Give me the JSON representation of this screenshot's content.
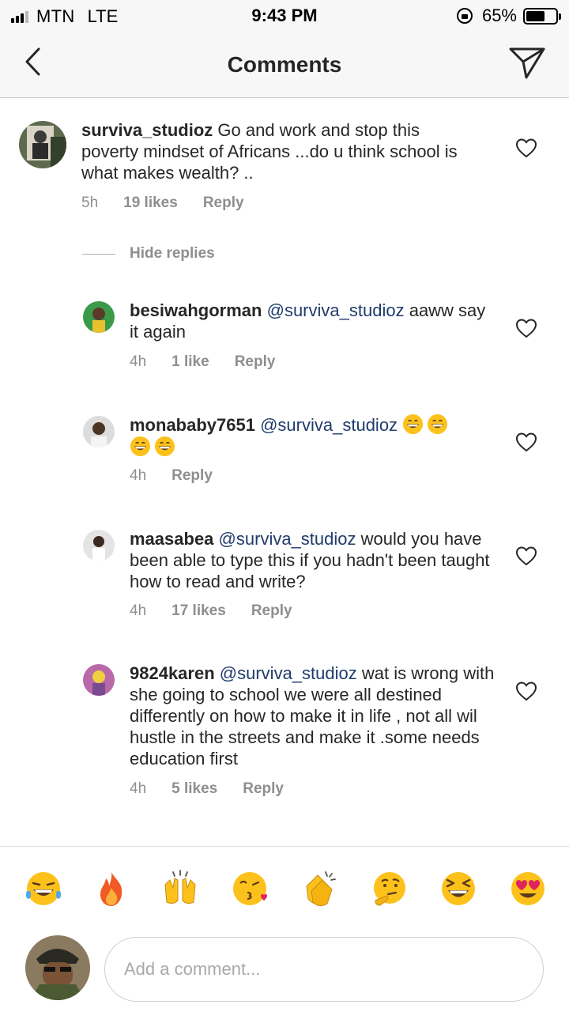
{
  "status_bar": {
    "carrier": "MTN",
    "network": "LTE",
    "time": "9:43 PM",
    "battery_text": "65%",
    "battery_level": 0.65,
    "signal_bars": 3,
    "icons": [
      "signal-icon",
      "orientation-lock-icon",
      "battery-icon"
    ]
  },
  "nav": {
    "title": "Comments",
    "back_icon": "chevron-left-icon",
    "send_icon": "paper-plane-icon"
  },
  "main_comment": {
    "username": "surviva_studioz",
    "text": "Go and work and stop this poverty mindset of Africans ...do u think school is what makes wealth? ..",
    "time": "5h",
    "likes": "19 likes",
    "reply": "Reply"
  },
  "hide_replies_label": "Hide replies",
  "replies": [
    {
      "username": "besiwahgorman",
      "mention": "@surviva_studioz",
      "text": "aaww say it again",
      "time": "4h",
      "likes": "1 like",
      "reply": "Reply"
    },
    {
      "username": "monababy7651",
      "mention": "@surviva_studioz",
      "text": "",
      "emojis": [
        "grinning-face",
        "grinning-face",
        "grinning-face",
        "grinning-face"
      ],
      "time": "4h",
      "likes": "",
      "reply": "Reply"
    },
    {
      "username": "maasabea",
      "mention": "@surviva_studioz",
      "text": "would you have been able to type this if you hadn't been taught how to read and write?",
      "time": "4h",
      "likes": "17 likes",
      "reply": "Reply"
    },
    {
      "username": "9824karen",
      "mention": "@surviva_studioz",
      "text": "wat is wrong with she going to school we were all destined differently on how to make it in life , not all wil hustle in the streets and make it .some needs education first",
      "time": "4h",
      "likes": "5 likes",
      "reply": "Reply"
    }
  ],
  "emoji_bar": [
    "tears-of-joy",
    "fire",
    "raising-hands",
    "face-blowing-kiss",
    "clapping-hands",
    "thinking-face",
    "grinning-squinting-face",
    "heart-eyes"
  ],
  "composer": {
    "placeholder": "Add a comment..."
  },
  "colors": {
    "text": "#262626",
    "muted": "#8e8e8e",
    "mention": "#1f3b6b",
    "bar_bg": "#f7f7f7"
  }
}
